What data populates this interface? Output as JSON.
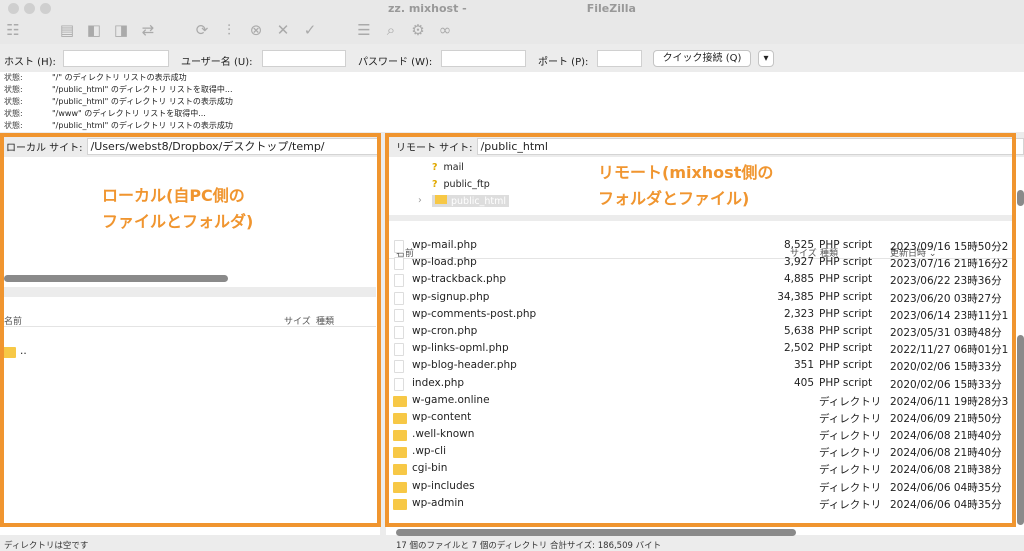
{
  "window": {
    "title": "zz. mixhost -",
    "app": "FileZilla"
  },
  "quickconnect": {
    "host_label": "ホスト (H):",
    "host_value": "",
    "user_label": "ユーザー名 (U):",
    "user_value": "",
    "pass_label": "パスワード (W):",
    "pass_value": "",
    "port_label": "ポート (P):",
    "port_value": "",
    "connect_label": "クイック接続 (Q)",
    "dropdown": "▾"
  },
  "log": [
    {
      "k": "状態:",
      "v": "\"/\" のディレクトリ リストの表示成功"
    },
    {
      "k": "状態:",
      "v": "\"/public_html\" のディレクトリ リストを取得中..."
    },
    {
      "k": "状態:",
      "v": "\"/public_html\" のディレクトリ リストの表示成功"
    },
    {
      "k": "状態:",
      "v": "\"/www\" のディレクトリ リストを取得中..."
    },
    {
      "k": "状態:",
      "v": "\"/public_html\" のディレクトリ リストの表示成功"
    }
  ],
  "local": {
    "site_label": "ローカル サイト:",
    "path": "/Users/webst8/Dropbox/デスクトップ/temp/",
    "annotation_line1": "ローカル(自PC側の",
    "annotation_line2": "ファイルとフォルダ)",
    "columns": {
      "name": "名前",
      "size": "サイズ",
      "type": "種類"
    },
    "files": [
      {
        "name": ".."
      }
    ],
    "status": "ディレクトリは空です"
  },
  "remote": {
    "site_label": "リモート サイト:",
    "path": "/public_html",
    "annotation_line1": "リモート(mixhost側の",
    "annotation_line2": "フォルダとファイル)",
    "tree": [
      {
        "name": "mail",
        "icon": "question-folder"
      },
      {
        "name": "public_ftp",
        "icon": "question-folder"
      },
      {
        "name": "public_html",
        "icon": "folder",
        "selected": true
      }
    ],
    "columns": {
      "name": "名前",
      "size": "サイズ",
      "type": "種類",
      "modified": "更新日時"
    },
    "files": [
      {
        "name": "wp-mail.php",
        "size": "8,525",
        "type": "PHP script",
        "modified": "2023/09/16 15時50分2",
        "kind": "file"
      },
      {
        "name": "wp-load.php",
        "size": "3,927",
        "type": "PHP script",
        "modified": "2023/07/16 21時16分2",
        "kind": "file"
      },
      {
        "name": "wp-trackback.php",
        "size": "4,885",
        "type": "PHP script",
        "modified": "2023/06/22 23時36分",
        "kind": "file"
      },
      {
        "name": "wp-signup.php",
        "size": "34,385",
        "type": "PHP script",
        "modified": "2023/06/20 03時27分",
        "kind": "file"
      },
      {
        "name": "wp-comments-post.php",
        "size": "2,323",
        "type": "PHP script",
        "modified": "2023/06/14 23時11分1",
        "kind": "file"
      },
      {
        "name": "wp-cron.php",
        "size": "5,638",
        "type": "PHP script",
        "modified": "2023/05/31 03時48分",
        "kind": "file"
      },
      {
        "name": "wp-links-opml.php",
        "size": "2,502",
        "type": "PHP script",
        "modified": "2022/11/27 06時01分1",
        "kind": "file"
      },
      {
        "name": "wp-blog-header.php",
        "size": "351",
        "type": "PHP script",
        "modified": "2020/02/06 15時33分",
        "kind": "file"
      },
      {
        "name": "index.php",
        "size": "405",
        "type": "PHP script",
        "modified": "2020/02/06 15時33分",
        "kind": "file"
      },
      {
        "name": "w-game.online",
        "size": "",
        "type": "ディレクトリ",
        "modified": "2024/06/11 19時28分3",
        "kind": "folder"
      },
      {
        "name": "wp-content",
        "size": "",
        "type": "ディレクトリ",
        "modified": "2024/06/09 21時50分",
        "kind": "folder"
      },
      {
        "name": ".well-known",
        "size": "",
        "type": "ディレクトリ",
        "modified": "2024/06/08 21時40分",
        "kind": "folder"
      },
      {
        "name": ".wp-cli",
        "size": "",
        "type": "ディレクトリ",
        "modified": "2024/06/08 21時40分",
        "kind": "folder"
      },
      {
        "name": "cgi-bin",
        "size": "",
        "type": "ディレクトリ",
        "modified": "2024/06/08 21時38分",
        "kind": "folder"
      },
      {
        "name": "wp-includes",
        "size": "",
        "type": "ディレクトリ",
        "modified": "2024/06/06 04時35分",
        "kind": "folder"
      },
      {
        "name": "wp-admin",
        "size": "",
        "type": "ディレクトリ",
        "modified": "2024/06/06 04時35分",
        "kind": "folder"
      }
    ],
    "status": "17 個のファイルと 7 個のディレクトリ 合計サイズ: 186,509 バイト"
  },
  "colors": {
    "annotation": "#f0952f",
    "folder": "#f7c846"
  }
}
